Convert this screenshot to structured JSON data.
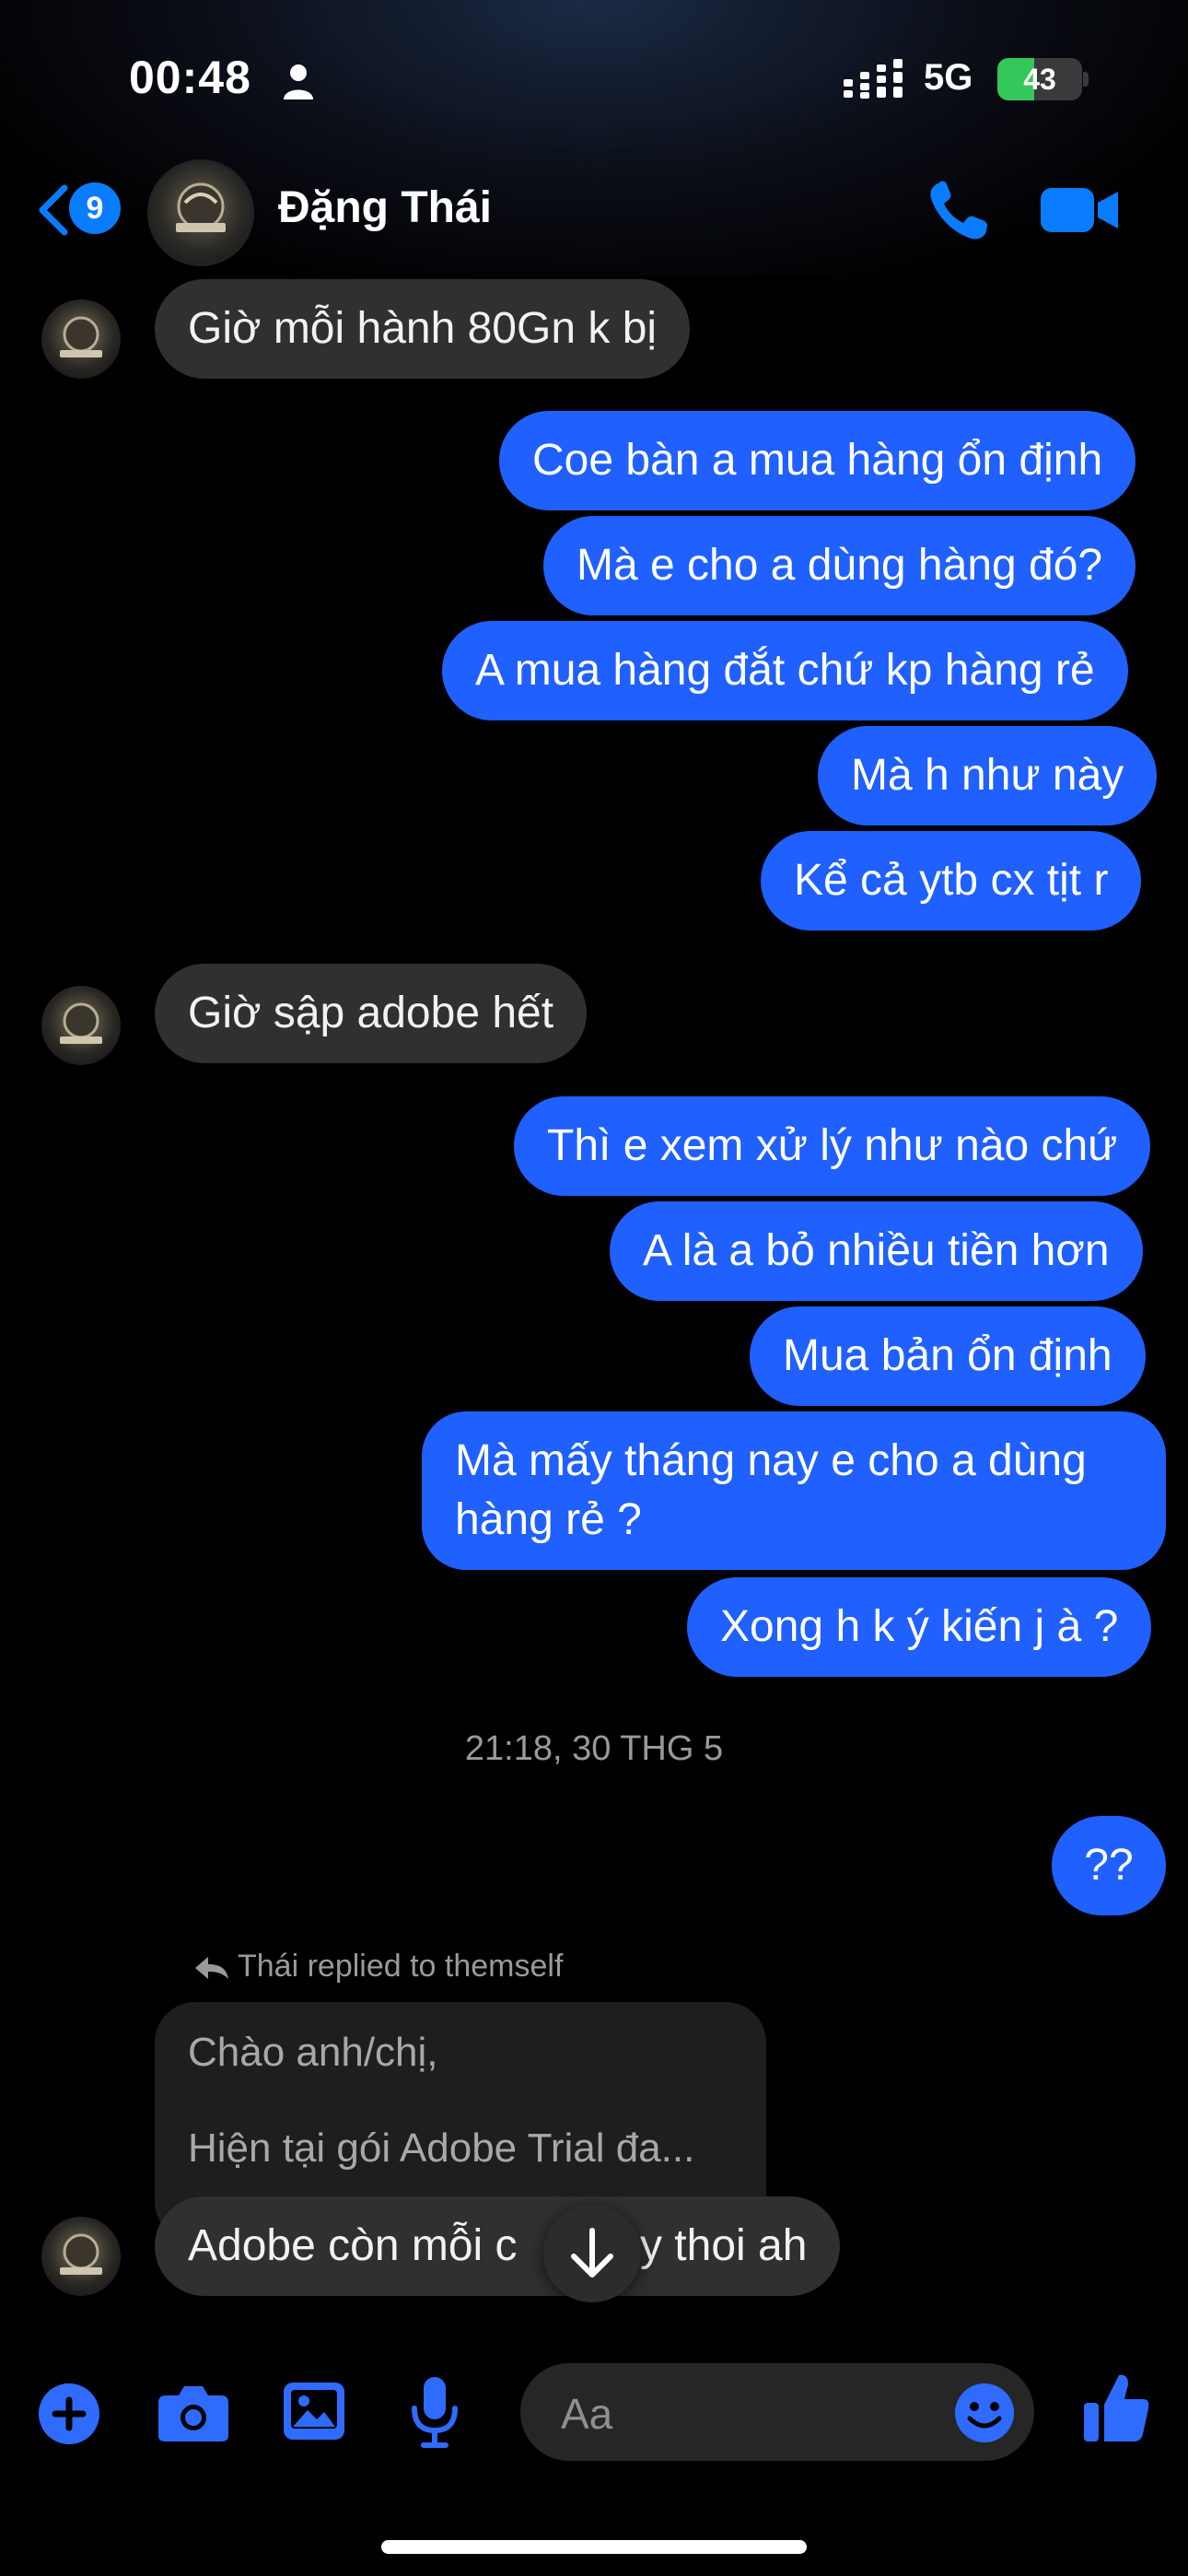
{
  "status_bar": {
    "time": "00:48",
    "network": "5G",
    "battery": "43",
    "battery_level": 0.43
  },
  "header": {
    "unread_count": "9",
    "contact_name": "Đặng Thái"
  },
  "messages": [
    {
      "dir": "in",
      "text": "Giờ mỗi hành 80Gn k bị"
    },
    {
      "dir": "out",
      "text": "Coe bàn a mua hàng ổn định"
    },
    {
      "dir": "out",
      "text": "Mà e cho a dùng hàng đó?"
    },
    {
      "dir": "out",
      "text": "A mua hàng đắt chứ kp hàng rẻ"
    },
    {
      "dir": "out",
      "text": "Mà h như này"
    },
    {
      "dir": "out",
      "text": "Kể cả ytb cx tịt r"
    },
    {
      "dir": "in",
      "text": "Giờ sập adobe hết"
    },
    {
      "dir": "out",
      "text": "Thì e xem xử lý như nào chứ"
    },
    {
      "dir": "out",
      "text": "A là a bỏ nhiều tiền hơn"
    },
    {
      "dir": "out",
      "text": "Mua bản ổn định"
    },
    {
      "dir": "out",
      "text": "Mà mấy tháng nay e cho a dùng hàng rẻ ?"
    },
    {
      "dir": "out",
      "text": "Xong h k ý kiến j à ?"
    },
    {
      "dir": "out",
      "text": "??"
    },
    {
      "dir": "in",
      "text": "Adobe còn mỗi c      này thoi ah"
    }
  ],
  "timestamp": "21:18, 30 THG 5",
  "reply": {
    "label": "Thái replied to themself",
    "quote_line1": "Chào anh/chị,",
    "quote_line2": "Hiện tại gói Adobe Trial đa..."
  },
  "composer": {
    "placeholder": "Aa"
  },
  "colors": {
    "outgoing": "#1f60ff",
    "incoming": "#303030",
    "accent": "#0a7cff"
  },
  "icons": [
    "back-chevron-icon",
    "phone-icon",
    "video-camera-icon",
    "plus-icon",
    "camera-icon",
    "image-icon",
    "microphone-icon",
    "emoji-icon",
    "thumbs-up-icon",
    "arrow-down-icon",
    "reply-arrow-icon"
  ]
}
